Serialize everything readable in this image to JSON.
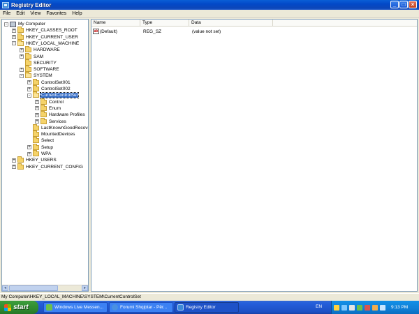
{
  "window": {
    "title": "Registry Editor"
  },
  "window_buttons": {
    "minimize": "_",
    "maximize": "□",
    "close": "×"
  },
  "menu": [
    "File",
    "Edit",
    "View",
    "Favorites",
    "Help"
  ],
  "tree": [
    {
      "label": "My Computer",
      "level": 0,
      "expander": "-",
      "icon": "computer-icon"
    },
    {
      "label": "HKEY_CLASSES_ROOT",
      "level": 1,
      "expander": "+",
      "icon": "folder-icon"
    },
    {
      "label": "HKEY_CURRENT_USER",
      "level": 1,
      "expander": "+",
      "icon": "folder-icon"
    },
    {
      "label": "HKEY_LOCAL_MACHINE",
      "level": 1,
      "expander": "-",
      "icon": "folder-open-icon"
    },
    {
      "label": "HARDWARE",
      "level": 2,
      "expander": "+",
      "icon": "folder-icon"
    },
    {
      "label": "SAM",
      "level": 2,
      "expander": "+",
      "icon": "folder-icon"
    },
    {
      "label": "SECURITY",
      "level": 2,
      "expander": "",
      "icon": "folder-icon"
    },
    {
      "label": "SOFTWARE",
      "level": 2,
      "expander": "+",
      "icon": "folder-icon"
    },
    {
      "label": "SYSTEM",
      "level": 2,
      "expander": "-",
      "icon": "folder-open-icon"
    },
    {
      "label": "ControlSet001",
      "level": 3,
      "expander": "+",
      "icon": "folder-icon"
    },
    {
      "label": "ControlSet002",
      "level": 3,
      "expander": "+",
      "icon": "folder-icon"
    },
    {
      "label": "CurrentControlSet",
      "level": 3,
      "expander": "-",
      "icon": "folder-open-icon",
      "selected": true
    },
    {
      "label": "Control",
      "level": 4,
      "expander": "+",
      "icon": "folder-icon"
    },
    {
      "label": "Enum",
      "level": 4,
      "expander": "+",
      "icon": "folder-icon"
    },
    {
      "label": "Hardware Profiles",
      "level": 4,
      "expander": "+",
      "icon": "folder-icon"
    },
    {
      "label": "Services",
      "level": 4,
      "expander": "+",
      "icon": "folder-icon"
    },
    {
      "label": "LastKnownGoodRecove",
      "level": 3,
      "expander": "",
      "icon": "folder-icon"
    },
    {
      "label": "MountedDevices",
      "level": 3,
      "expander": "",
      "icon": "folder-icon"
    },
    {
      "label": "Select",
      "level": 3,
      "expander": "",
      "icon": "folder-icon"
    },
    {
      "label": "Setup",
      "level": 3,
      "expander": "+",
      "icon": "folder-icon"
    },
    {
      "label": "WPA",
      "level": 3,
      "expander": "+",
      "icon": "folder-icon"
    },
    {
      "label": "HKEY_USERS",
      "level": 1,
      "expander": "+",
      "icon": "folder-icon"
    },
    {
      "label": "HKEY_CURRENT_CONFIG",
      "level": 1,
      "expander": "+",
      "icon": "folder-icon"
    }
  ],
  "list": {
    "columns": [
      "Name",
      "Type",
      "Data"
    ],
    "rows": [
      {
        "name": "(Default)",
        "type": "REG_SZ",
        "data": "(value not set)",
        "icon_text": "ab"
      }
    ]
  },
  "scrollbar": {
    "left": "◂",
    "right": "▸"
  },
  "status": {
    "path": "My Computer\\HKEY_LOCAL_MACHINE\\SYSTEM\\CurrentControlSet"
  },
  "taskbar": {
    "start_label": "start",
    "tasks": [
      {
        "label": "Windows Live Messen...",
        "icon_color": "#6cc04a"
      },
      {
        "label": "Forumi Shqiptar - Për...",
        "icon_color": "#4a90e2"
      },
      {
        "label": "Registry Editor",
        "icon_color": "#3c8ad8",
        "active": true
      }
    ],
    "language": "EN",
    "clock": "9:13 PM"
  },
  "colors": {
    "titlebar": "#0349c8",
    "selection": "#316ac5",
    "taskbar": "#245edb",
    "start_button": "#2f8a2f",
    "tray": "#0f7fd6"
  }
}
